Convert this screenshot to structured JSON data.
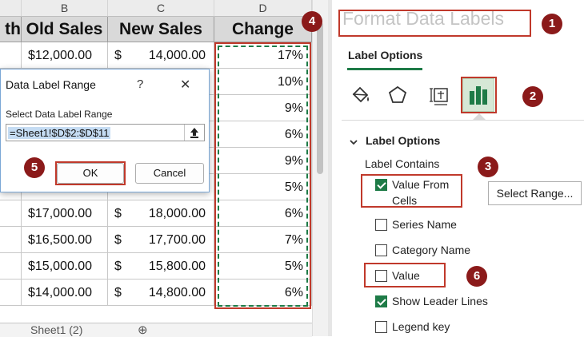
{
  "sheet": {
    "col_letters": [
      "B",
      "C",
      "D"
    ],
    "headers": [
      "th",
      "Old Sales",
      "New Sales",
      "Change"
    ],
    "rows": [
      {
        "old": "$12,000.00",
        "new": "14,000.00",
        "change": "17%"
      },
      {
        "old": "",
        "new": "",
        "change": "10%"
      },
      {
        "old": "",
        "new": "",
        "change": "9%"
      },
      {
        "old": "",
        "new": "",
        "change": "6%"
      },
      {
        "old": "",
        "new": "",
        "change": "9%"
      },
      {
        "old": "",
        "new": "",
        "change": "5%"
      },
      {
        "old": "$17,000.00",
        "new": "18,000.00",
        "change": "6%"
      },
      {
        "old": "$16,500.00",
        "new": "17,700.00",
        "change": "7%"
      },
      {
        "old": "$15,000.00",
        "new": "15,800.00",
        "change": "5%"
      },
      {
        "old": "$14,000.00",
        "new": "14,800.00",
        "change": "6%"
      }
    ],
    "dollar_sign": "$",
    "sheet_tab": "Sheet1 (2)",
    "add_sheet": "⊕"
  },
  "dialog": {
    "title": "Data Label Range",
    "help": "?",
    "close": "✕",
    "prompt": "Select Data Label Range",
    "range_value": "=Sheet1!$D$2:$D$11",
    "ok_label": "OK",
    "cancel_label": "Cancel"
  },
  "panel": {
    "title": "Format Data Labels",
    "tab_label": "Label Options",
    "section_title": "Label Options",
    "section_subtitle": "Label Contains",
    "options": [
      {
        "label": "Value From Cells",
        "checked": true
      },
      {
        "label": "Series Name",
        "checked": false
      },
      {
        "label": "Category Name",
        "checked": false
      },
      {
        "label": "Value",
        "checked": false
      },
      {
        "label": "Show Leader Lines",
        "checked": true
      },
      {
        "label": "Legend key",
        "checked": false
      }
    ],
    "value_from_cells_line1": "Value From",
    "value_from_cells_line2": "Cells",
    "select_range_label": "Select Range..."
  },
  "badges": [
    "1",
    "2",
    "3",
    "4",
    "5",
    "6"
  ],
  "colors": {
    "accent_green": "#1e7b47",
    "badge": "#8b1a1a",
    "highlight_box": "#c0392b"
  }
}
